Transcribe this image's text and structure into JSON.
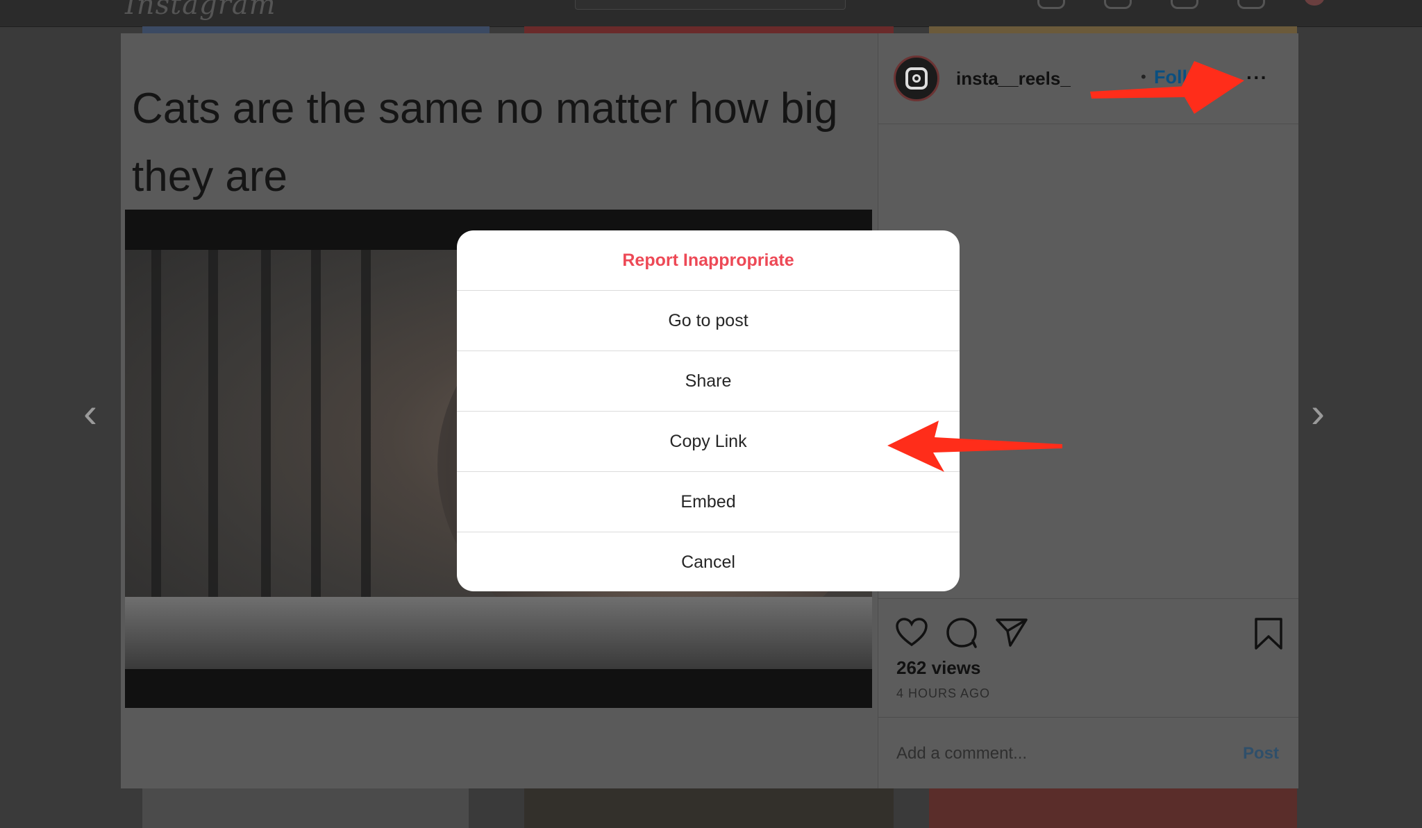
{
  "app": {
    "logo_text": "Instagram"
  },
  "post": {
    "caption": "Cats are the same no matter how big they are",
    "username": "insta__reels_",
    "separator": "•",
    "follow_label": "Follow",
    "more_label": "···",
    "views": "262 views",
    "time_ago": "4 HOURS AGO",
    "comment_placeholder": "Add a comment...",
    "post_button": "Post"
  },
  "modal": {
    "items": [
      {
        "label": "Report Inappropriate",
        "style": "danger"
      },
      {
        "label": "Go to post"
      },
      {
        "label": "Share"
      },
      {
        "label": "Copy Link"
      },
      {
        "label": "Embed"
      },
      {
        "label": "Cancel"
      }
    ]
  },
  "nav": {
    "prev_glyph": "‹",
    "next_glyph": "›"
  },
  "colors": {
    "danger": "#ed4956",
    "follow": "#0095f6",
    "annotation_arrow": "#ff2d1a"
  },
  "icons": [
    "heart-icon",
    "comment-icon",
    "share-paper-plane-icon",
    "bookmark-icon",
    "more-options-icon",
    "instagram-logo-icon"
  ]
}
